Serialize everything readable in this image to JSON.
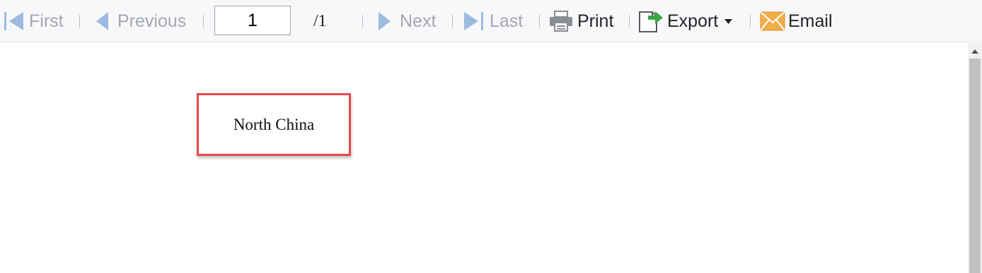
{
  "toolbar": {
    "first_label": "First",
    "previous_label": "Previous",
    "page_value": "1",
    "page_total": "/1",
    "next_label": "Next",
    "last_label": "Last",
    "print_label": "Print",
    "export_label": "Export",
    "email_label": "Email",
    "icons": {
      "first": "first-page-icon",
      "previous": "previous-page-icon",
      "next": "next-page-icon",
      "last": "last-page-icon",
      "print": "printer-icon",
      "export": "export-icon",
      "export_dropdown": "caret-down-icon",
      "email": "envelope-icon"
    },
    "colors": {
      "disabled_text": "#a4a7ad",
      "enabled_text": "#222427",
      "nav_icon": "#9dbbe0",
      "export_arrow": "#3aa54a",
      "email_icon": "#f0ae4a"
    }
  },
  "report": {
    "cell_text": "North China",
    "colors": {
      "cell_border": "#e8494d"
    }
  }
}
